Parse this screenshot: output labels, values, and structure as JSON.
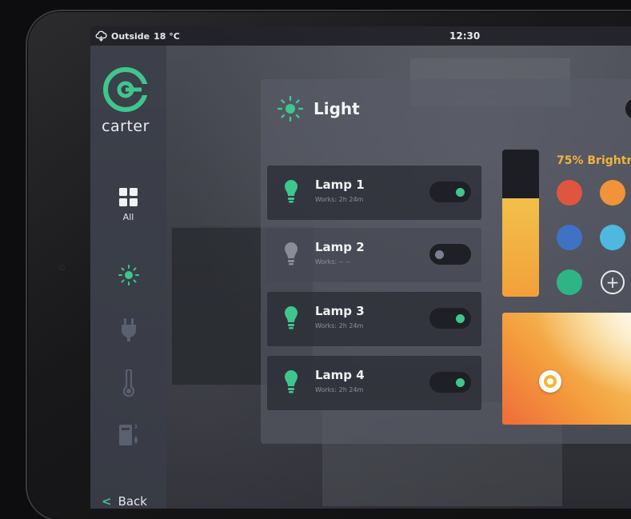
{
  "status_bar": {
    "weather_label": "Outside",
    "temperature": "18 °C",
    "time": "12:30"
  },
  "sidebar": {
    "logo_text": "carter",
    "items": [
      {
        "label": "All",
        "icon": "grid-icon",
        "active": false
      },
      {
        "label": "",
        "icon": "light-icon",
        "active": true
      },
      {
        "label": "",
        "icon": "plug-icon",
        "active": false
      },
      {
        "label": "",
        "icon": "thermometer-icon",
        "active": false
      },
      {
        "label": "",
        "icon": "appliance-icon",
        "active": false
      }
    ],
    "back_label": "Back"
  },
  "panel": {
    "title": "Light",
    "lamps": [
      {
        "name": "Lamp 1",
        "works": "Works: 2h 24m",
        "on": true
      },
      {
        "name": "Lamp 2",
        "works": "Works: -- --",
        "on": false
      },
      {
        "name": "Lamp 3",
        "works": "Works: 2h 24m",
        "on": true
      },
      {
        "name": "Lamp 4",
        "works": "Works: 2h 24m",
        "on": true
      }
    ],
    "brightness_label": "75% Brightn",
    "brightness_fraction": 0.67,
    "swatches": [
      "#e0553e",
      "#f0933a",
      "#3f72c4",
      "#4fb8e0",
      "#2fb585"
    ],
    "add_color_symbol": "+"
  },
  "colors": {
    "accent_green": "#3fc68f",
    "brightness_orange": "#f2b33d",
    "lamp_off_gray": "#8a8d96"
  }
}
